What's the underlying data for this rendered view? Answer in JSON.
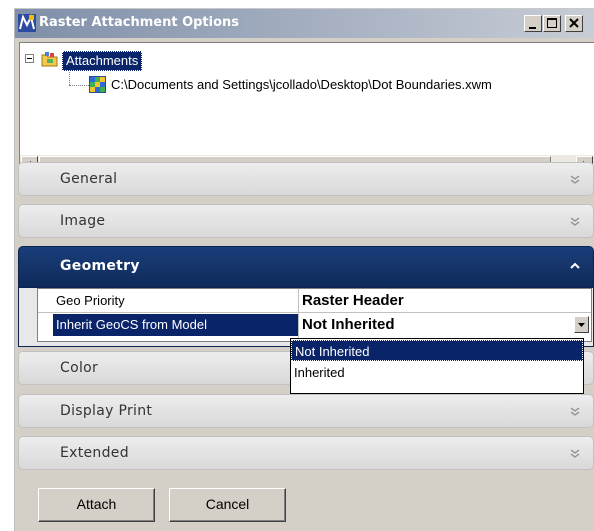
{
  "window": {
    "title": "Raster Attachment Options"
  },
  "tree": {
    "root_label": "Attachments",
    "child_path": "C:\\Documents and Settings\\jcollado\\Desktop\\Dot Boundaries.xwm"
  },
  "sections": {
    "general": "General",
    "image": "Image",
    "geometry": "Geometry",
    "color": "Color",
    "display_print": "Display Print",
    "extended": "Extended"
  },
  "geometry_props": [
    {
      "key": "Geo Priority",
      "value": "Raster Header"
    },
    {
      "key": "Inherit GeoCS from Model",
      "value": "Not Inherited"
    }
  ],
  "dropdown": {
    "options": [
      "Not Inherited",
      "Inherited"
    ],
    "selected": "Not Inherited"
  },
  "buttons": {
    "attach": "Attach",
    "cancel": "Cancel"
  },
  "icons": {
    "app": "microstation-logo-icon",
    "folder": "attachments-folder-icon",
    "raster": "raster-grid-icon"
  },
  "colors": {
    "selection": "#0a246a",
    "active_section": "#1a3e7a"
  }
}
